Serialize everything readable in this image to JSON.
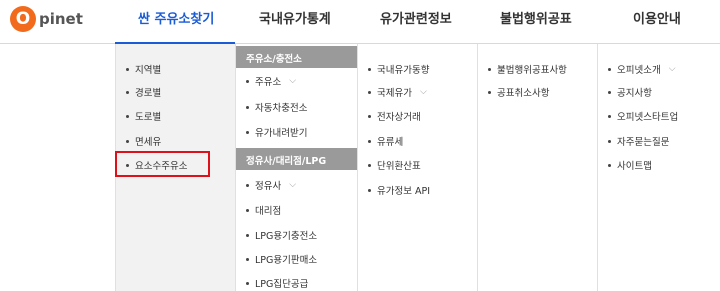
{
  "logo": {
    "letter": "O",
    "text": "pinet"
  },
  "gnb": {
    "items": [
      "싼 주유소찾기",
      "국내유가통계",
      "유가관련정보",
      "불법행위공표",
      "이용안내"
    ]
  },
  "menu": {
    "col1": [
      "지역별",
      "경로별",
      "도로별",
      "면세유",
      "요소수주유소"
    ],
    "col2": {
      "section1": "주유소/충전소",
      "section1_items": [
        "주유소",
        "자동차충전소",
        "유가내려받기"
      ],
      "section2": "정유사/대리점/LPG",
      "section2_items": [
        "정유사",
        "대리점",
        "LPG용기충전소",
        "LPG용기판매소",
        "LPG집단공급"
      ]
    },
    "col3": [
      "국내유가동향",
      "국제유가",
      "전자상거래",
      "유류세",
      "단위환산표",
      "유가정보 API"
    ],
    "col4": [
      "불법행위공표사항",
      "공표취소사항"
    ],
    "col5": [
      "오피넷소개",
      "공지사항",
      "오피넷스타트업",
      "자주묻는질문",
      "사이트맵"
    ]
  },
  "icons": {
    "expand": "chevron-down-icon",
    "bullet": "bullet-dot-icon"
  },
  "colors": {
    "accent": "#1a5bd6",
    "logo": "#f26b1d",
    "section_header": "#9a9a9a",
    "highlight": "#e0101a"
  }
}
